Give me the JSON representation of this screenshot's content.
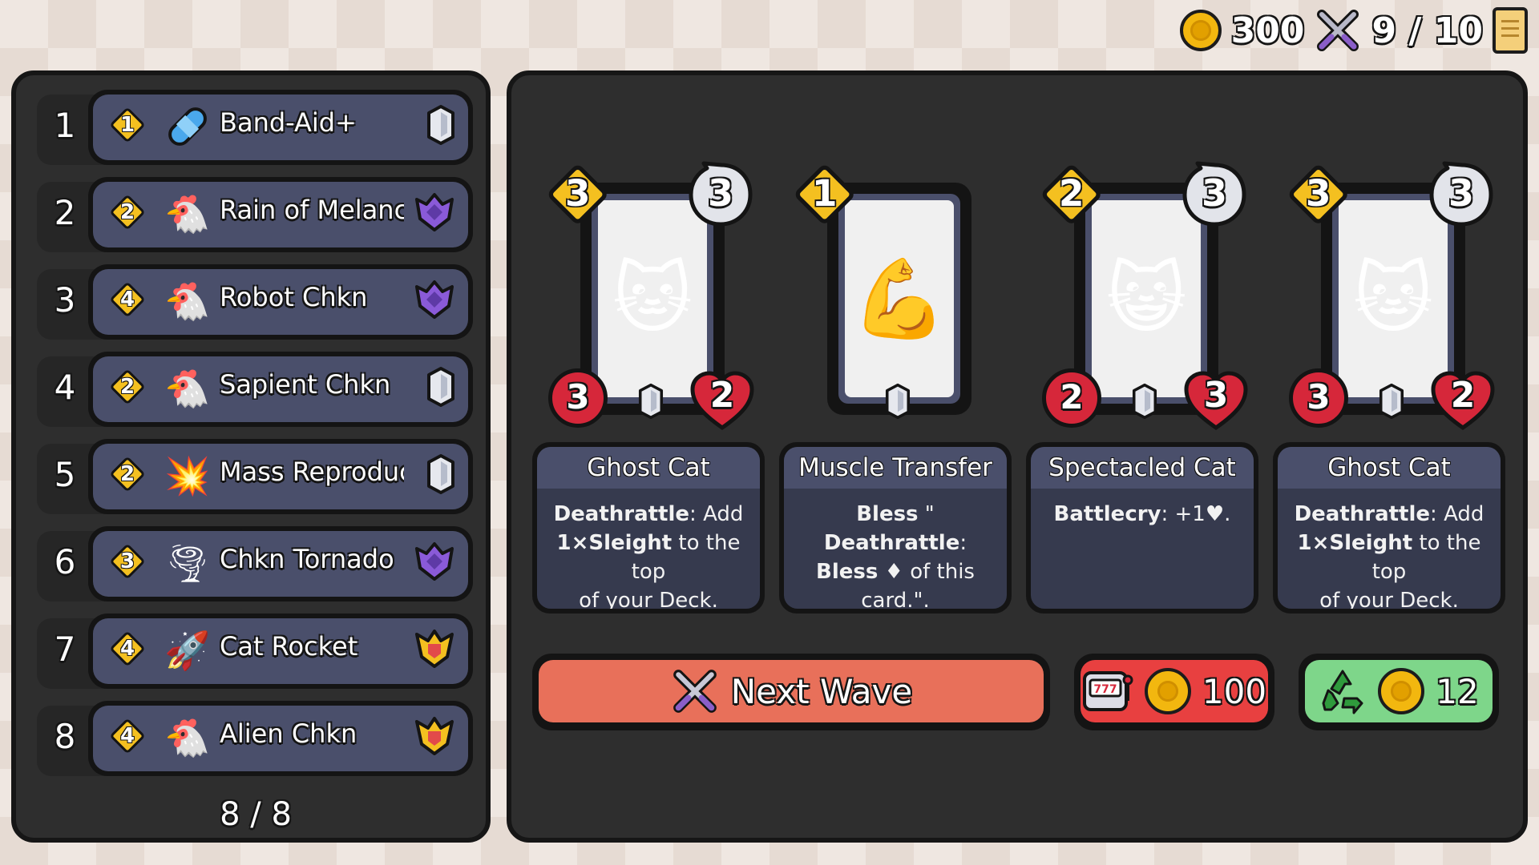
{
  "top_bar": {
    "gold": "300",
    "wave": "9 / 10",
    "icons": [
      "coin-icon",
      "crossed-swords-icon",
      "scroll-icon"
    ]
  },
  "spell_list": {
    "items": [
      {
        "index": "1",
        "cost": "1",
        "icon": "bandage-icon",
        "glyph": "",
        "name": "Band-Aid+",
        "rank": "silver"
      },
      {
        "index": "2",
        "cost": "2",
        "icon": "chef-chicken-icon",
        "glyph": "🐔",
        "name": "Rain of Melancholy",
        "rank": "purple"
      },
      {
        "index": "3",
        "cost": "4",
        "icon": "robot-chicken-icon",
        "glyph": "🐔",
        "name": "Robot Chkn",
        "rank": "purple"
      },
      {
        "index": "4",
        "cost": "2",
        "icon": "chicken-icon",
        "glyph": "🐔",
        "name": "Sapient Chkn",
        "rank": "silver"
      },
      {
        "index": "5",
        "cost": "2",
        "icon": "explosion-icon",
        "glyph": "💥",
        "name": "Mass Reproduction",
        "rank": "silver"
      },
      {
        "index": "6",
        "cost": "3",
        "icon": "tornado-icon",
        "glyph": "🌪",
        "name": "Chkn Tornado",
        "rank": "purple"
      },
      {
        "index": "7",
        "cost": "4",
        "icon": "cat-rocket-icon",
        "glyph": "🚀",
        "name": "Cat Rocket",
        "rank": "gold"
      },
      {
        "index": "8",
        "cost": "4",
        "icon": "alien-chicken-icon",
        "glyph": "🐔",
        "name": "Alien Chkn",
        "rank": "gold"
      }
    ],
    "counter": "8 / 8"
  },
  "shop": {
    "cards": [
      {
        "name": "Ghost Cat",
        "cost": "3",
        "cooldown": "3",
        "attack": "3",
        "health": "2",
        "art": "ghost-cat-icon",
        "glyph": "🐱",
        "desc": [
          {
            "b": "Deathrattle",
            "t": ": Add"
          },
          {
            "b": "1×Sleight",
            "t": " to the top"
          },
          {
            "b": "",
            "t": "of your Deck."
          }
        ]
      },
      {
        "name": "Muscle Transfer",
        "cost": "1",
        "cooldown": "",
        "attack": "",
        "health": "",
        "art": "flexed-bicep-icon",
        "glyph": "💪",
        "desc": [
          {
            "b": "Bless",
            "t": " \""
          },
          {
            "b": "Deathrattle",
            "t": ":"
          },
          {
            "b": "Bless",
            "t": " ♦ of this"
          },
          {
            "b": "",
            "t": "card.\"."
          }
        ]
      },
      {
        "name": "Spectacled Cat",
        "cost": "2",
        "cooldown": "3",
        "attack": "2",
        "health": "3",
        "art": "glasses-cat-icon",
        "glyph": "😺",
        "desc": [
          {
            "b": "Battlecry",
            "t": ": +1♥."
          }
        ]
      },
      {
        "name": "Ghost Cat",
        "cost": "3",
        "cooldown": "3",
        "attack": "3",
        "health": "2",
        "art": "ghost-cat-icon",
        "glyph": "🐱",
        "desc": [
          {
            "b": "Deathrattle",
            "t": ": Add"
          },
          {
            "b": "1×Sleight",
            "t": " to the top"
          },
          {
            "b": "",
            "t": "of your Deck."
          }
        ]
      }
    ],
    "next_wave_label": "Next Wave",
    "reroll_cost": "100",
    "recycle_value": "12"
  },
  "colors": {
    "panel": "#2e2e2e",
    "pill": "#4a4f6b",
    "gold": "#f4c020",
    "next_wave": "#e8705a",
    "reroll": "#e84040",
    "recycle": "#7ed68a",
    "heart": "#d6273a"
  }
}
